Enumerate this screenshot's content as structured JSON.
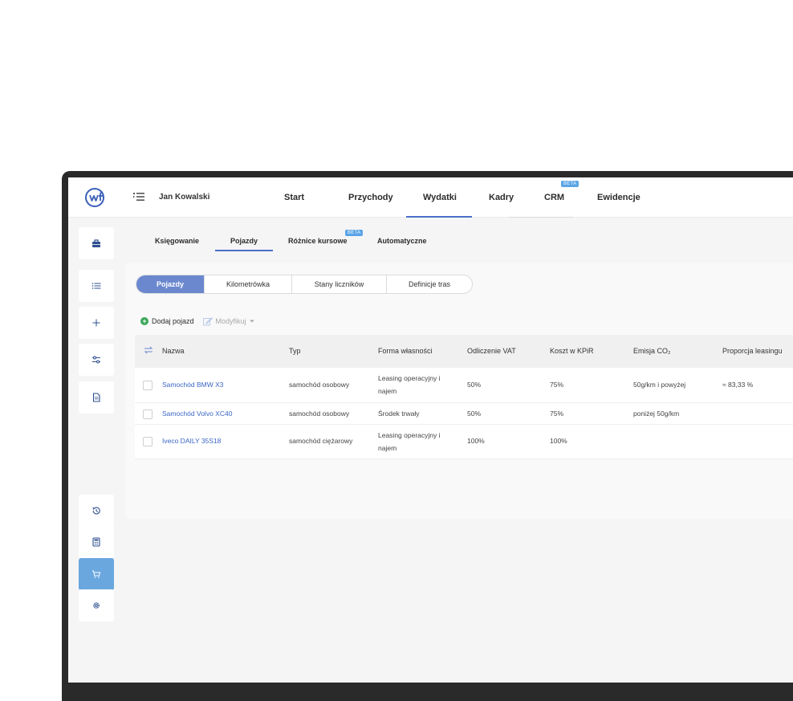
{
  "header": {
    "user_name": "Jan Kowalski",
    "nav": [
      {
        "label": "Start"
      },
      {
        "label": "Przychody"
      },
      {
        "label": "Wydatki",
        "active": true
      },
      {
        "label": "Kadry"
      },
      {
        "label": "CRM",
        "badge": "BETA"
      },
      {
        "label": "Ewidencje"
      }
    ]
  },
  "sidebar": {
    "items": [
      {
        "icon": "briefcase-icon"
      },
      {
        "icon": "list-icon"
      },
      {
        "icon": "plus-icon"
      },
      {
        "icon": "filters-icon"
      },
      {
        "icon": "document-icon"
      },
      {
        "icon": "history-icon"
      },
      {
        "icon": "calculator-icon"
      },
      {
        "icon": "cart-icon",
        "active": true
      },
      {
        "icon": "gear-icon"
      }
    ]
  },
  "subnav": {
    "items": [
      {
        "label": "Księgowanie"
      },
      {
        "label": "Pojazdy",
        "active": true
      },
      {
        "label": "Różnice kursowe",
        "badge": "BETA"
      },
      {
        "label": "Automatyczne"
      }
    ]
  },
  "segmented": {
    "items": [
      {
        "label": "Pojazdy",
        "active": true
      },
      {
        "label": "Kilometrówka"
      },
      {
        "label": "Stany liczników"
      },
      {
        "label": "Definicje tras"
      }
    ]
  },
  "toolbar": {
    "add_label": "Dodaj pojazd",
    "modify_label": "Modyfikuj"
  },
  "table": {
    "columns": [
      "Nazwa",
      "Typ",
      "Forma własności",
      "Odliczenie VAT",
      "Koszt w KPiR",
      "Emisja CO₂",
      "Proporcja leasingu"
    ],
    "rows": [
      {
        "name": "Samochód BMW X3",
        "type": "samochód osobowy",
        "ownership": "Leasing operacyjny i najem",
        "vat": "50%",
        "kpir": "75%",
        "co2": "50g/km i powyżej",
        "leasing": "≈ 83,33 %"
      },
      {
        "name": "Samochód Volvo XC40",
        "type": "samochód osobowy",
        "ownership": "Środek trwały",
        "vat": "50%",
        "kpir": "75%",
        "co2": "poniżej 50g/km",
        "leasing": ""
      },
      {
        "name": "Iveco DAILY 35S18",
        "type": "samochód ciężarowy",
        "ownership": "Leasing operacyjny i najem",
        "vat": "100%",
        "kpir": "100%",
        "co2": "",
        "leasing": ""
      }
    ]
  },
  "colors": {
    "accent": "#4a6fc8",
    "active_segment": "#6b88cf",
    "active_sidebar": "#6aa7df",
    "beta_badge": "#5aa4e6",
    "link": "#3b66c4",
    "add_green": "#3aa657"
  }
}
